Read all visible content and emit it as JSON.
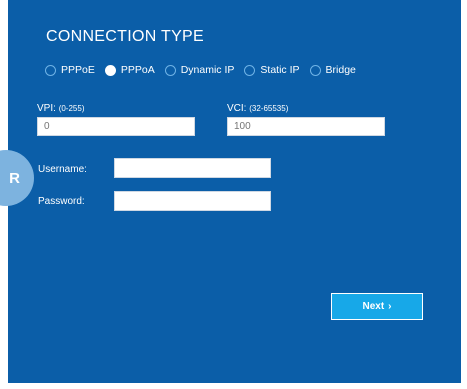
{
  "connection": {
    "title": "CONNECTION TYPE",
    "options": [
      {
        "label": "PPPoE",
        "selected": false
      },
      {
        "label": "PPPoA",
        "selected": true
      },
      {
        "label": "Dynamic IP",
        "selected": false
      },
      {
        "label": "Static IP",
        "selected": false
      },
      {
        "label": "Bridge",
        "selected": false
      }
    ]
  },
  "vpi": {
    "label": "VPI:",
    "hint": "(0-255)",
    "placeholder": "0"
  },
  "vci": {
    "label": "VCI:",
    "hint": "(32-65535)",
    "placeholder": "100"
  },
  "login": {
    "username_label": "Username:",
    "password_label": "Password:"
  },
  "next_button": {
    "label": "Next",
    "chevron": "›"
  },
  "side_badge": {
    "letter": "R"
  },
  "colors": {
    "panel": "#0b5ea8",
    "button": "#17a8e8",
    "badge": "#7db3df"
  }
}
